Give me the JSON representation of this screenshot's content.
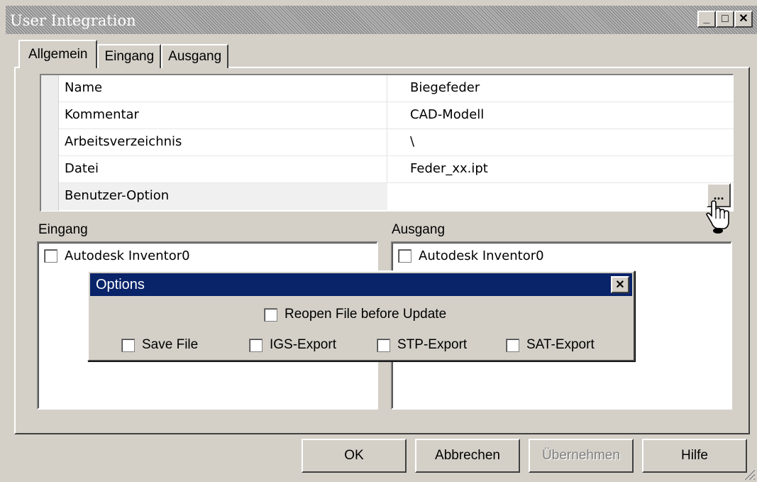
{
  "window": {
    "title": "User Integration",
    "controls": [
      "_",
      "□",
      "✕"
    ]
  },
  "tabs": [
    {
      "label": "Allgemein",
      "active": true
    },
    {
      "label": "Eingang",
      "active": false
    },
    {
      "label": "Ausgang",
      "active": false
    }
  ],
  "properties": [
    {
      "key": "Name",
      "value": "Biegefeder"
    },
    {
      "key": "Kommentar",
      "value": "CAD-Modell"
    },
    {
      "key": "Arbeitsverzeichnis",
      "value": "\\"
    },
    {
      "key": "Datei",
      "value": "Feder_xx.ipt"
    },
    {
      "key": "Benutzer-Option",
      "value": ""
    }
  ],
  "browse_button": "...",
  "eingang": {
    "label": "Eingang",
    "items": [
      {
        "label": "Autodesk Inventor0",
        "checked": false
      }
    ]
  },
  "ausgang": {
    "label": "Ausgang",
    "items": [
      {
        "label": "Autodesk Inventor0",
        "checked": false
      }
    ]
  },
  "options_dialog": {
    "title": "Options",
    "close": "✕",
    "reopen": {
      "label": "Reopen File before Update",
      "checked": false
    },
    "checks": [
      {
        "label": "Save File",
        "checked": false
      },
      {
        "label": "IGS-Export",
        "checked": false
      },
      {
        "label": "STP-Export",
        "checked": false
      },
      {
        "label": "SAT-Export",
        "checked": false
      }
    ]
  },
  "buttons": {
    "ok": "OK",
    "cancel": "Abbrechen",
    "apply": "Übernehmen",
    "help": "Hilfe"
  }
}
